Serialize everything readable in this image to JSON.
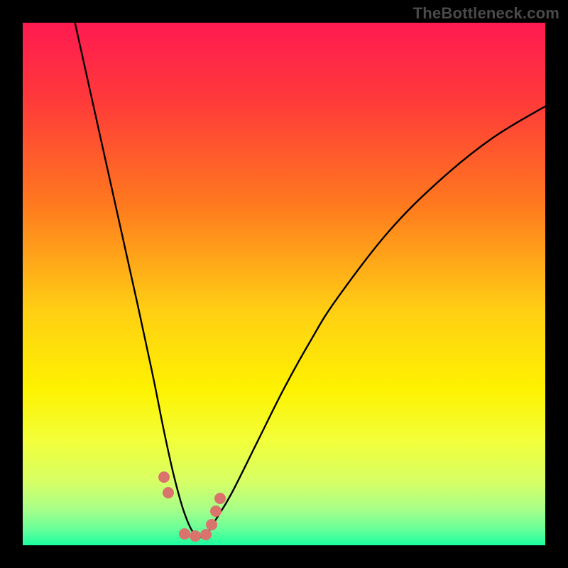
{
  "watermark": "TheBottleneck.com",
  "colors": {
    "frame": "#000000",
    "curve": "#000000",
    "dot": "#d9736b",
    "gradient_stops": [
      {
        "offset": 0.0,
        "color": "#ff1a51"
      },
      {
        "offset": 0.15,
        "color": "#ff3a3a"
      },
      {
        "offset": 0.35,
        "color": "#ff7a1e"
      },
      {
        "offset": 0.55,
        "color": "#ffcf14"
      },
      {
        "offset": 0.7,
        "color": "#fef200"
      },
      {
        "offset": 0.8,
        "color": "#f2ff3a"
      },
      {
        "offset": 0.88,
        "color": "#d6ff66"
      },
      {
        "offset": 0.93,
        "color": "#a8ff88"
      },
      {
        "offset": 0.97,
        "color": "#66ff99"
      },
      {
        "offset": 1.0,
        "color": "#1aff9f"
      }
    ]
  },
  "chart_data": {
    "type": "line",
    "title": "",
    "xlabel": "",
    "ylabel": "",
    "xlim": [
      0,
      100
    ],
    "ylim": [
      0,
      100
    ],
    "note": "V-shaped bottleneck curve. x is a normalized component scale (0–100); y is bottleneck severity (0 = none at bottom, 100 = severe at top). Minimum near x≈33.",
    "series": [
      {
        "name": "bottleneck-curve",
        "x": [
          10,
          14,
          18,
          22,
          25,
          27,
          29,
          31,
          33,
          35,
          37,
          40,
          45,
          50,
          55,
          60,
          70,
          80,
          90,
          100
        ],
        "y": [
          100,
          82,
          64,
          46,
          32,
          22,
          13,
          6,
          2,
          2,
          5,
          10,
          20,
          30,
          39,
          47,
          60,
          70,
          78,
          84
        ]
      }
    ],
    "highlight_points": {
      "name": "optimal-range-dots",
      "x": [
        27.0,
        27.8,
        31.0,
        33.0,
        35.0,
        36.2,
        37.0,
        37.8
      ],
      "y": [
        13.0,
        10.0,
        2.2,
        1.8,
        2.0,
        4.0,
        6.5,
        9.0
      ]
    }
  }
}
